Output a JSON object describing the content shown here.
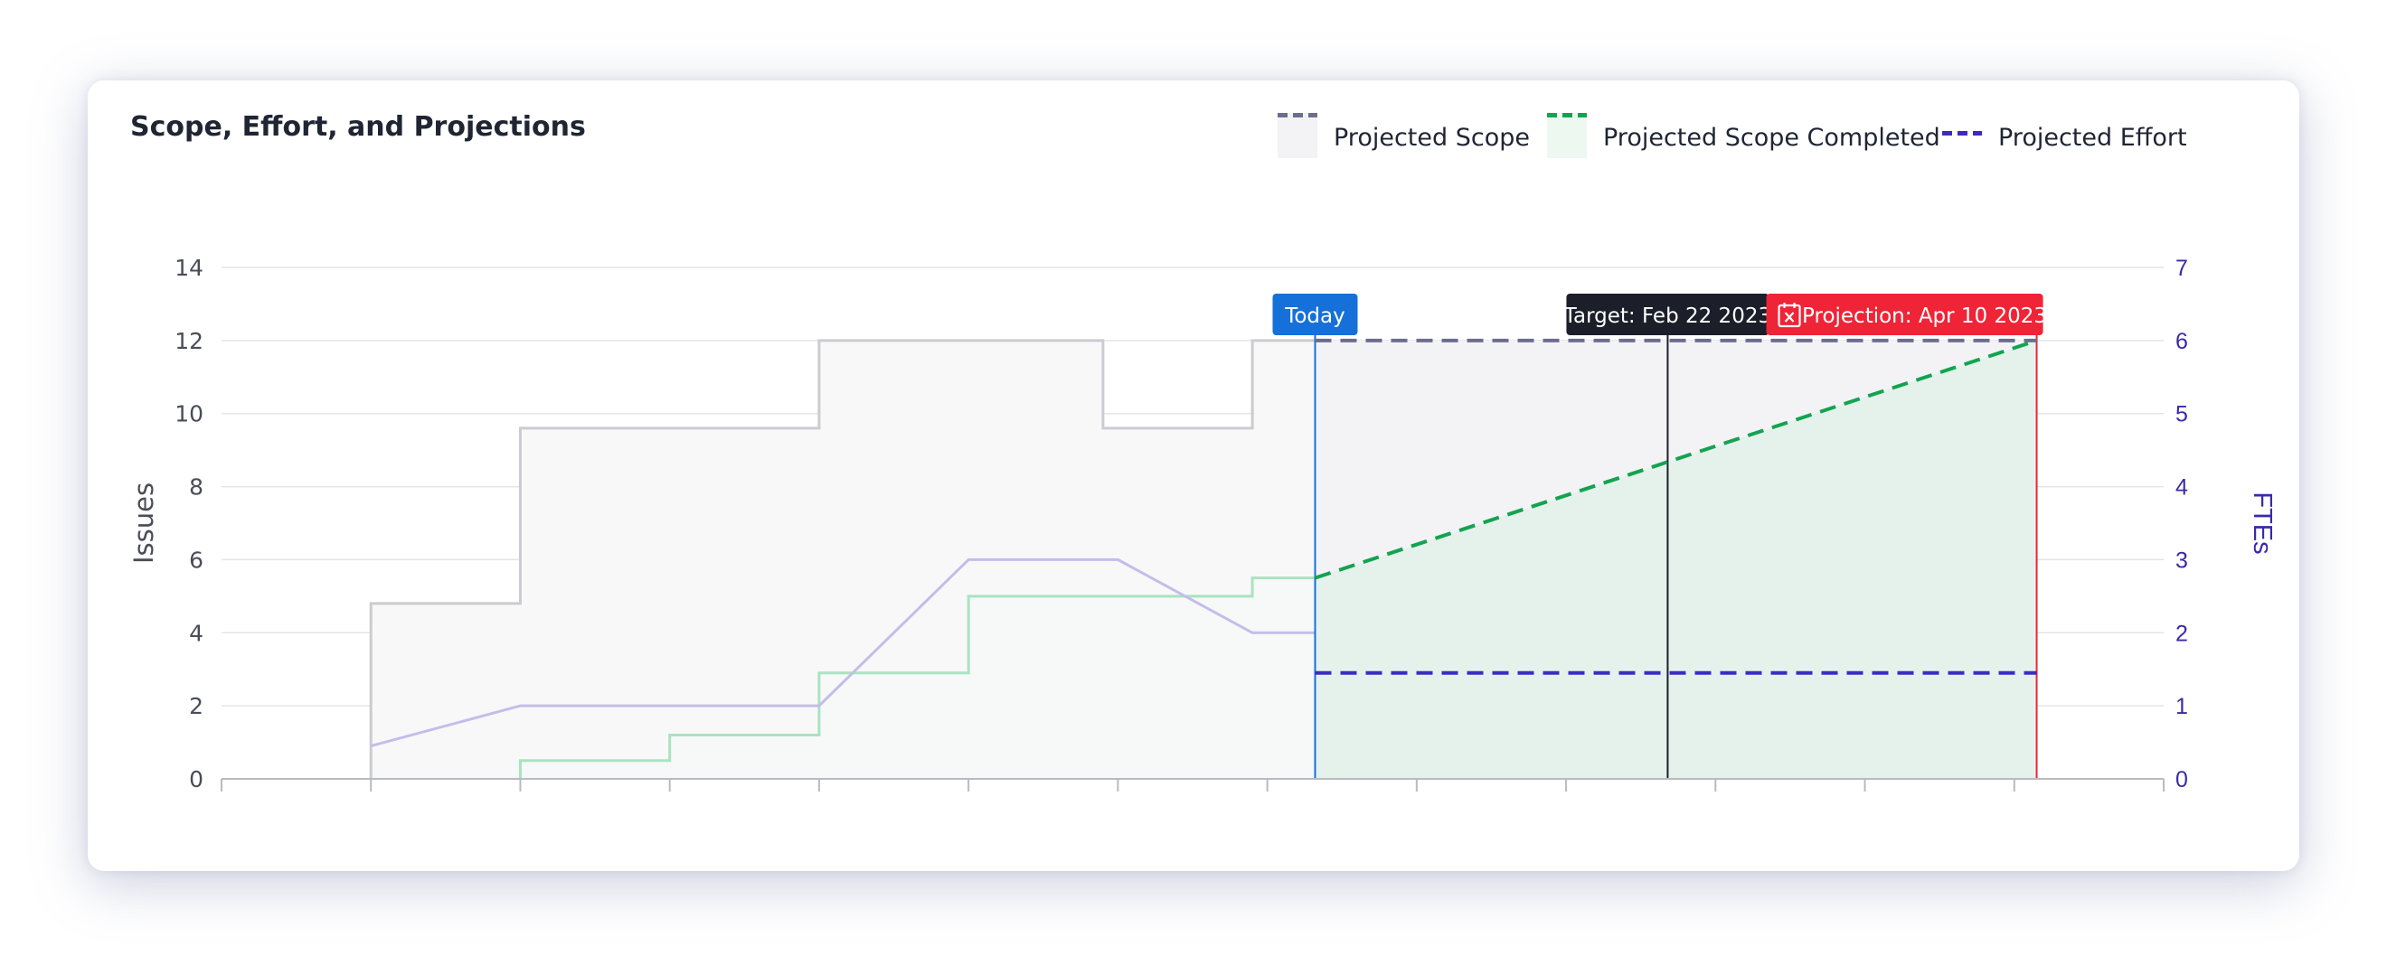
{
  "title": "Scope, Effort, and Projections",
  "legend": [
    {
      "label": "Projected Scope",
      "color": "#6b6e8e",
      "fill": "#f3f3f6"
    },
    {
      "label": "Projected Scope Completed",
      "color": "#14a350",
      "fill": "#ecf8f0"
    },
    {
      "label": "Projected Effort",
      "color": "#3b2bc4"
    }
  ],
  "markers": {
    "today": {
      "label": "Today",
      "color": "#1570d9"
    },
    "target": {
      "label": "Target: Feb 22 2023",
      "color": "#1c1f2a"
    },
    "projection": {
      "label": "Projection: Apr 10 2023",
      "color": "#ef2436",
      "icon": "calendar-x-icon"
    }
  },
  "chart_data": {
    "type": "line",
    "left_axis": {
      "label": "Issues",
      "ticks": [
        0,
        2,
        4,
        6,
        8,
        10,
        12,
        14
      ],
      "range": [
        0,
        14
      ]
    },
    "right_axis": {
      "label": "FTEs",
      "ticks": [
        0,
        1,
        2,
        3,
        4,
        5,
        6,
        7
      ],
      "range": [
        0,
        7
      ],
      "color": "#3a2aa8"
    },
    "x_range": [
      0,
      13
    ],
    "x_tick_count": 13,
    "grid": true,
    "markers_x": {
      "today": 7.32,
      "target": 9.68,
      "projection": 12.15
    },
    "series": [
      {
        "key": "scope",
        "color": "#cbcbd1",
        "fill": "#f8f8f9",
        "points": [
          [
            1,
            0
          ],
          [
            1,
            4.8
          ],
          [
            2,
            4.8
          ],
          [
            2,
            9.6
          ],
          [
            4,
            9.6
          ],
          [
            4,
            12
          ],
          [
            5.9,
            12
          ],
          [
            5.9,
            9.6
          ],
          [
            6.9,
            9.6
          ],
          [
            6.9,
            12
          ],
          [
            7.32,
            12
          ]
        ]
      },
      {
        "key": "completed",
        "color": "#a9e3c0",
        "fill": "#f7f8f8",
        "points": [
          [
            2,
            0
          ],
          [
            2,
            0.5
          ],
          [
            3,
            0.5
          ],
          [
            3,
            1.2
          ],
          [
            4,
            1.2
          ],
          [
            4,
            2.9
          ],
          [
            5,
            2.9
          ],
          [
            5,
            5
          ],
          [
            6.9,
            5
          ],
          [
            6.9,
            5.5
          ],
          [
            7.32,
            5.5
          ]
        ]
      },
      {
        "key": "effort",
        "axis": "right",
        "color": "#c4bde9",
        "points": [
          [
            1,
            0.45
          ],
          [
            2,
            1
          ],
          [
            4,
            1
          ],
          [
            5,
            3
          ],
          [
            6,
            3
          ],
          [
            6.9,
            2
          ],
          [
            7.32,
            2
          ]
        ]
      },
      {
        "key": "projected-scope",
        "color": "#6b6e8e",
        "dashed": true,
        "fill": "#f3f3f6",
        "points": [
          [
            7.32,
            12
          ],
          [
            12.15,
            12
          ]
        ]
      },
      {
        "key": "projected-completed",
        "color": "#14a350",
        "dashed": true,
        "fill": "#e5f2ec",
        "points": [
          [
            7.32,
            5.5
          ],
          [
            12.15,
            12
          ]
        ]
      },
      {
        "key": "projected-effort",
        "axis": "right",
        "color": "#3b2bc4",
        "dashed": true,
        "points": [
          [
            7.32,
            1.45
          ],
          [
            12.15,
            1.45
          ]
        ]
      }
    ]
  }
}
